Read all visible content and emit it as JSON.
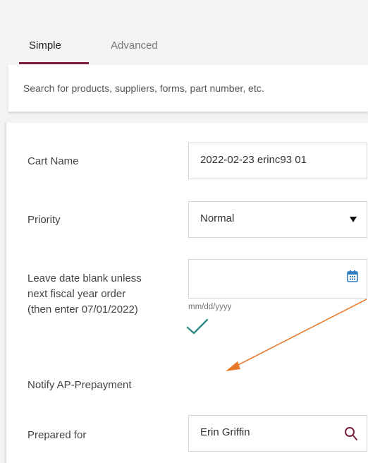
{
  "tabs": {
    "simple": "Simple",
    "advanced": "Advanced"
  },
  "search": {
    "placeholder": "Search for products, suppliers, forms, part number, etc."
  },
  "form": {
    "cart_name_label": "Cart Name",
    "cart_name_value": "2022-02-23 erinc93 01",
    "priority_label": "Priority",
    "priority_value": "Normal",
    "date_label_line1": "Leave date blank unless",
    "date_label_line2": "next fiscal year order",
    "date_label_line3": "(then enter 07/01/2022)",
    "date_hint": "mm/dd/yyyy",
    "notify_label": "Notify AP-Prepayment",
    "prepared_for_label": "Prepared for",
    "prepared_for_value": "Erin Griffin"
  },
  "colors": {
    "accent": "#7b1f3a",
    "check": "#2e8b84",
    "annotation_arrow": "#e8792b",
    "calendar_icon": "#2f7cc1"
  },
  "icons": [
    "calendar-icon",
    "checkmark-icon",
    "search-icon",
    "dropdown-caret-icon"
  ]
}
